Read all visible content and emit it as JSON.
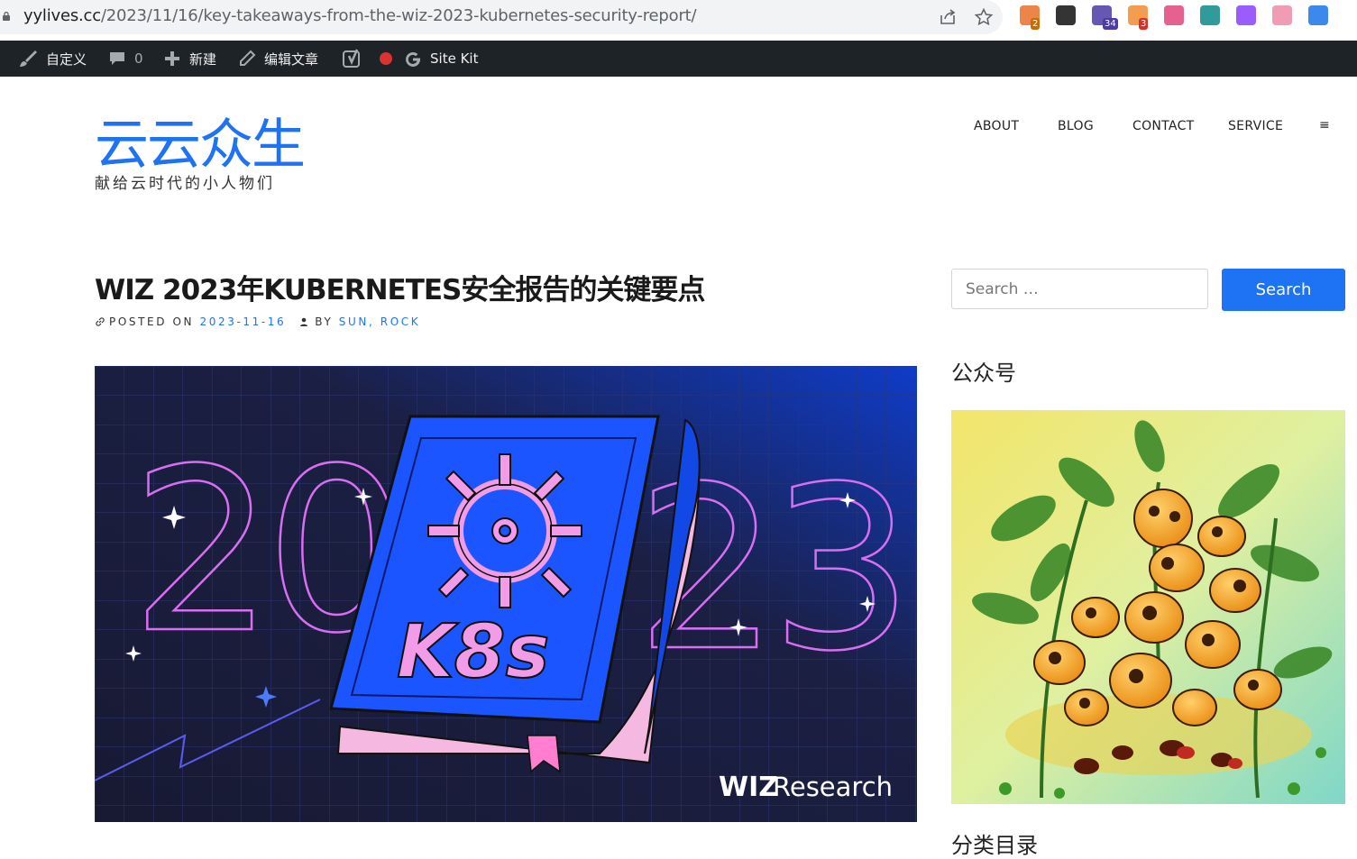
{
  "browser": {
    "url_host": "yylives.cc",
    "url_path": "/2023/11/16/key-takeaways-from-the-wiz-2023-kubernetes-security-report/",
    "extensions": [
      {
        "name": "colorful-circle-extension",
        "badge": "2",
        "color": "#e8702a",
        "badge_color": "#c86b00"
      },
      {
        "name": "notion-extension",
        "badge": "",
        "color": "#111111"
      },
      {
        "name": "graduation-cap-extension",
        "badge": "34",
        "color": "#4b3aa8",
        "badge_color": "#4b3aa8"
      },
      {
        "name": "orange-blob-extension",
        "badge": "3",
        "color": "#f28b30",
        "badge_color": "#d93025"
      },
      {
        "name": "translate-extension",
        "badge": "",
        "color": "#e0457b"
      },
      {
        "name": "teal-square-extension",
        "badge": "",
        "color": "#0d8a8a"
      },
      {
        "name": "purple-circle-extension",
        "badge": "",
        "color": "#8a3ffc"
      },
      {
        "name": "crown-extension",
        "badge": "",
        "color": "#f08aa8"
      },
      {
        "name": "blue-arrow-extension",
        "badge": "",
        "color": "#1a73e8"
      }
    ]
  },
  "adminbar": {
    "customize": "自定义",
    "comments_count": "0",
    "new": "新建",
    "edit": "编辑文章",
    "sitekit": "Site Kit"
  },
  "site": {
    "title": "云云众生",
    "description": "献给云时代的小人物们",
    "nav": [
      "ABOUT",
      "BLOG",
      "CONTACT",
      "SERVICE"
    ],
    "menu_toggle": "≡",
    "accent": "#1e73f5"
  },
  "post": {
    "title": "WIZ 2023年KUBERNETES安全报告的关键要点",
    "posted_on_label": "POSTED ON",
    "date": "2023-11-16",
    "by_label": "BY",
    "author": "SUN, ROCK",
    "image": {
      "year_left": "20",
      "year_right": "23",
      "book_text": "K8s",
      "brand": "WIZ",
      "brand_suffix": "Research"
    }
  },
  "sidebar": {
    "search_placeholder": "Search …",
    "search_button": "Search",
    "widget_title": "公众号",
    "widget_title_next": "分类目录"
  }
}
